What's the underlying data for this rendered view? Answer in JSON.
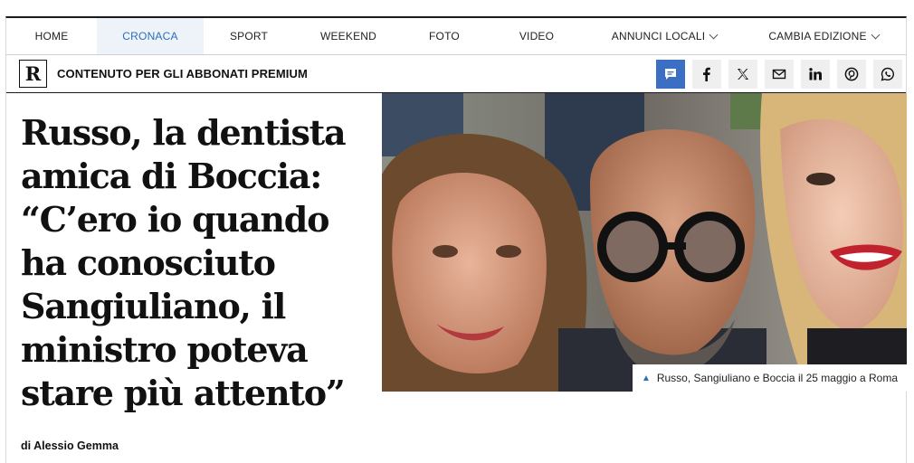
{
  "nav": {
    "items": [
      {
        "label": "HOME",
        "active": false
      },
      {
        "label": "CRONACA",
        "active": true
      },
      {
        "label": "SPORT",
        "active": false
      },
      {
        "label": "WEEKEND",
        "active": false
      },
      {
        "label": "FOTO",
        "active": false
      },
      {
        "label": "VIDEO",
        "active": false
      },
      {
        "label": "ANNUNCI LOCALI",
        "active": false,
        "dropdown": true
      },
      {
        "label": "CAMBIA EDIZIONE",
        "active": false,
        "dropdown": true
      }
    ]
  },
  "subbar": {
    "logo": "R",
    "premium_label": "CONTENUTO PER GLI ABBONATI PREMIUM",
    "share_icons": [
      "comment-icon",
      "facebook-icon",
      "x-icon",
      "email-icon",
      "linkedin-icon",
      "pinterest-icon",
      "whatsapp-icon"
    ]
  },
  "article": {
    "headline": "Russo, la dentista amica di Boccia: “C’ero io quando ha conosciuto Sangiuliano, il ministro poteva stare più attento”",
    "byline": "di Alessio Gemma",
    "caption": "Russo, Sangiuliano e Boccia il 25 maggio a Roma"
  },
  "colors": {
    "accent": "#2a6ebb",
    "share_active": "#3a6fc4",
    "rule": "#1a1a1a"
  }
}
